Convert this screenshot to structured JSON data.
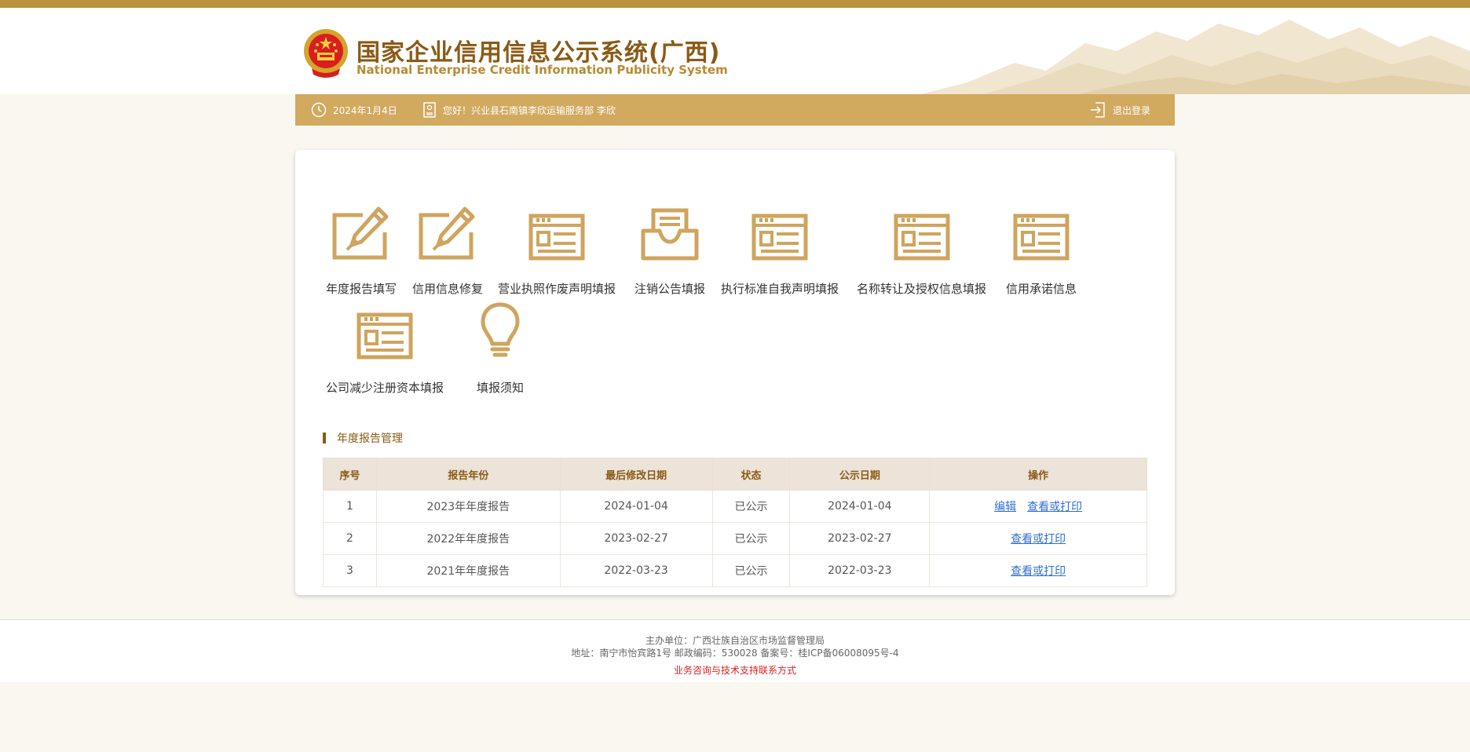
{
  "header": {
    "title": "国家企业信用信息公示系统(广西)",
    "subtitle": "National Enterprise Credit Information Publicity System"
  },
  "infobar": {
    "date": "2024年1月4日",
    "greeting": "您好！兴业县石南镇李欣运输服务部  李欣",
    "logout": "退出登录"
  },
  "functions": [
    {
      "label": "年度报告填写",
      "icon": "edit-icon"
    },
    {
      "label": "信用信息修复",
      "icon": "edit-icon"
    },
    {
      "label": "营业执照作废声明填报",
      "icon": "form-icon"
    },
    {
      "label": "注销公告填报",
      "icon": "inbox-icon"
    },
    {
      "label": "执行标准自我声明填报",
      "icon": "form-icon"
    },
    {
      "label": "名称转让及授权信息填报",
      "icon": "form-icon"
    },
    {
      "label": "信用承诺信息",
      "icon": "form-icon"
    },
    {
      "label": "公司减少注册资本填报",
      "icon": "form-icon"
    },
    {
      "label": "填报须知",
      "icon": "lightbulb-icon"
    }
  ],
  "section": {
    "title": "年度报告管理"
  },
  "table": {
    "headers": [
      "序号",
      "报告年份",
      "最后修改日期",
      "状态",
      "公示日期",
      "操作"
    ],
    "rows": [
      {
        "no": "1",
        "year": "2023年年度报告",
        "modified": "2024-01-04",
        "status": "已公示",
        "published": "2024-01-04",
        "edit": "编辑",
        "view": "查看或打印"
      },
      {
        "no": "2",
        "year": "2022年年度报告",
        "modified": "2023-02-27",
        "status": "已公示",
        "published": "2023-02-27",
        "view": "查看或打印"
      },
      {
        "no": "3",
        "year": "2021年年度报告",
        "modified": "2022-03-23",
        "status": "已公示",
        "published": "2022-03-23",
        "view": "查看或打印"
      }
    ]
  },
  "footer": {
    "sponsor": "主办单位：广西壮族自治区市场监督管理局",
    "address": "地址：南宁市怡宾路1号 邮政编码：530028    备案号：桂ICP备06008095号-4",
    "contact": "业务咨询与技术支持联系方式"
  },
  "colors": {
    "gold": "#d1a95f",
    "dark_gold": "#8a5a14",
    "icon": "#cfa45e",
    "link": "#2f6fd1",
    "alert": "#e02020"
  }
}
